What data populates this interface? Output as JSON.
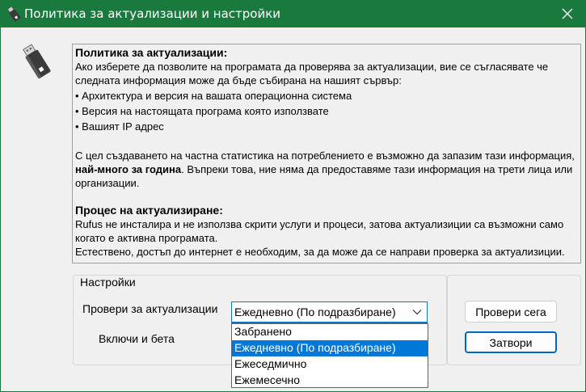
{
  "window": {
    "title": "Политика за актуализации и настройки",
    "accent": "#1a7a3e",
    "icons": {
      "title": "usb-drive-icon",
      "close": "close-icon",
      "logo": "usb-drive-icon"
    }
  },
  "policy": {
    "heading1": "Политика за актуализации:",
    "p1": "Ако изберете да позволите на програмата да проверява за актуализации, вие се съгласявате че следната информация може да бъде събирана на нашият сървър:",
    "bullets": [
      "Архитектура и версия на вашата операционна система",
      "Версия на настоящата програма която използвате",
      "Вашият IP адрес"
    ],
    "p2_before": "С цел създаването на частна статистика на потреблението е възможно да запазим тази информация, ",
    "p2_bold": "най-много за година",
    "p2_after": ". Въпреки това, ние няма да предоставяме тази информация на трети лица или организации.",
    "heading2": "Процес на актуализиране:",
    "p3": "Rufus не инсталира и не използва скрити услуги и процеси, затова актуализиции са възможни само когато е активна програмата.",
    "p4": "Естествено, достъп до интернет е необходим, за да може да се направи проверка за актуализиции."
  },
  "settings": {
    "legend": "Настройки",
    "check_label": "Провери за актуализации",
    "beta_label": "Включи и бета",
    "selected": "Ежедневно (По подразбиране)",
    "options": [
      "Забранено",
      "Ежедневно (По подразбиране)",
      "Ежеседмично",
      "Ежемесечно"
    ],
    "selected_index": 1
  },
  "buttons": {
    "check_now": "Провери сега",
    "close": "Затвори"
  }
}
